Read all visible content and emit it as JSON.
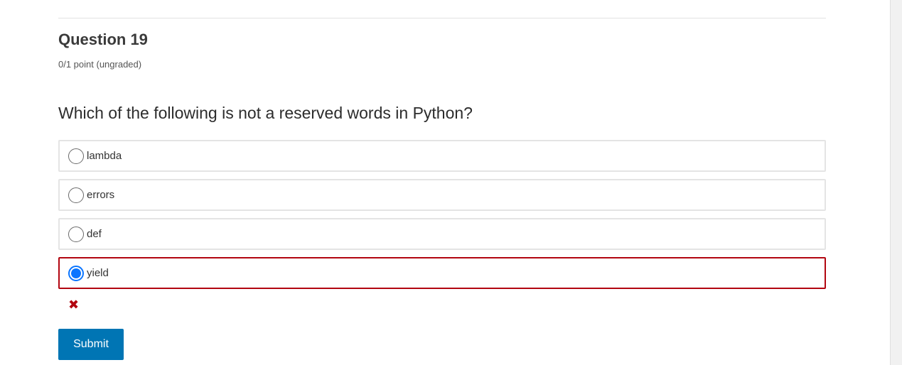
{
  "question": {
    "title": "Question 19",
    "points": "0/1 point (ungraded)",
    "prompt": "Which of the following is not a reserved words in Python?"
  },
  "choices": [
    {
      "label": "lambda",
      "selected": false
    },
    {
      "label": "errors",
      "selected": false
    },
    {
      "label": "def",
      "selected": false
    },
    {
      "label": "yield",
      "selected": true
    }
  ],
  "result": {
    "icon": "incorrect-x-icon",
    "glyph": "✖",
    "status": "incorrect",
    "color": "#b20610"
  },
  "actions": {
    "submit_label": "Submit"
  },
  "colors": {
    "accent": "#0075b4",
    "radio_selected": "#0a75ff",
    "error": "#b20610"
  }
}
